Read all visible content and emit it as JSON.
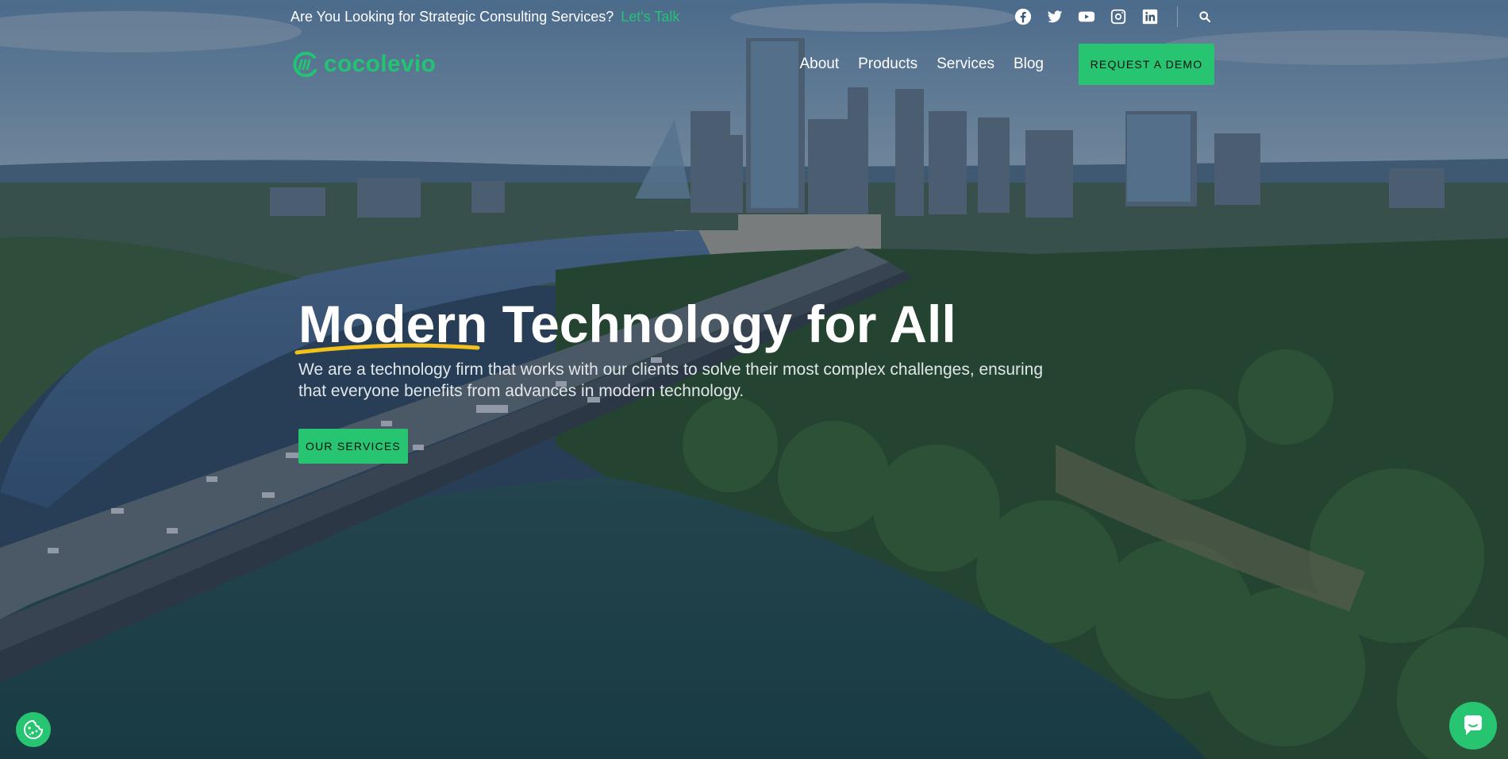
{
  "topbar": {
    "message": "Are You Looking for Strategic Consulting Services?",
    "link_label": "Let's Talk",
    "icons": [
      "facebook-icon",
      "twitter-icon",
      "youtube-icon",
      "instagram-icon",
      "linkedin-icon",
      "search-icon"
    ]
  },
  "nav": {
    "logo_text": "cocolevio",
    "links": [
      "About",
      "Products",
      "Services",
      "Blog"
    ],
    "cta_label": "REQUEST A DEMO"
  },
  "hero": {
    "title_highlight": "Modern",
    "title_rest": "Technology for All",
    "subtitle": "We are a technology firm that works with our clients to solve their most complex challenges, ensuring that everyone benefits from advances in modern technology.",
    "button_label": "OUR SERVICES"
  },
  "floating": {
    "cookie_icon": "cookie-icon",
    "chat_icon": "chat-icon"
  },
  "colors": {
    "accent": "#27c571",
    "link": "#22c473",
    "underline": "#f2c21b"
  }
}
